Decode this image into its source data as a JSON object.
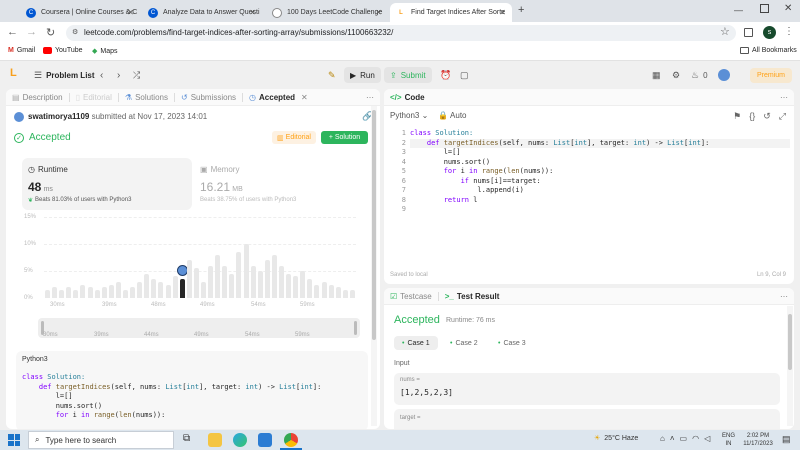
{
  "browser": {
    "tabs": [
      {
        "title": "Coursera | Online Courses & C"
      },
      {
        "title": "Analyze Data to Answer Questi"
      },
      {
        "title": "100 Days LeetCode Challenge"
      },
      {
        "title": "Find Target Indices After Sorte"
      }
    ],
    "new_tab": "+",
    "url": "leetcode.com/problems/find-target-indices-after-sorting-array/submissions/1100663232/",
    "profile_letter": "s",
    "bookmarks": [
      "Gmail",
      "YouTube",
      "Maps"
    ],
    "all_bookmarks": "All Bookmarks"
  },
  "lc_nav": {
    "problem_list": "Problem List",
    "run": "Run",
    "submit": "Submit",
    "notifications": "0",
    "premium": "Premium"
  },
  "left": {
    "tabs": [
      "Description",
      "Editorial",
      "Solutions",
      "Submissions",
      "Accepted"
    ],
    "user": "swatimorya1109",
    "submitted": "submitted at Nov 17, 2023 14:01",
    "status": "Accepted",
    "editorial_btn": "Editorial",
    "solution_btn": "+ Solution",
    "runtime": {
      "label": "Runtime",
      "value": "48",
      "unit": "ms",
      "beats": "Beats 81.03% of users with Python3"
    },
    "memory": {
      "label": "Memory",
      "value": "16.21",
      "unit": "MB",
      "beats": "Beats 38.75% of users with Python3"
    },
    "chart_y_ticks": [
      "15%",
      "10%",
      "5%",
      "0%"
    ],
    "chart_x_ticks": [
      "30ms",
      "39ms",
      "48ms",
      "49ms",
      "54ms",
      "59ms"
    ],
    "chart_x_ticks2": [
      "30ms",
      "39ms",
      "44ms",
      "49ms",
      "54ms",
      "59ms"
    ],
    "chart_data": {
      "type": "bar",
      "title": "",
      "xlabel": "",
      "ylabel": "",
      "ylim": [
        0,
        15
      ],
      "values": [
        1.5,
        2,
        1.5,
        2,
        1.5,
        2.5,
        2,
        1.5,
        2,
        2.5,
        3,
        1.5,
        2,
        3,
        4.5,
        3.5,
        3,
        2.5,
        4,
        6,
        7,
        5.5,
        3,
        6,
        8,
        6,
        4.5,
        8.5,
        10,
        6,
        5,
        7,
        8,
        6,
        4.5,
        4,
        5,
        3.5,
        2.5,
        3,
        2.5,
        2,
        1.5,
        1.5
      ],
      "highlight_index": 19,
      "highlight_value": 3.5
    },
    "code_lang": "Python3",
    "code_lines": [
      "class Solution:",
      "    def targetIndices(self, nums: List[int], target: int) -> List[int]:",
      "        l=[]",
      "        nums.sort()",
      "        for i in range(len(nums)):"
    ]
  },
  "editor": {
    "title": "Code",
    "lang": "Python3",
    "mode": "Auto",
    "line_numbers": [
      "1",
      "2",
      "3",
      "4",
      "5",
      "6",
      "7",
      "8",
      "9"
    ],
    "lines": [
      "class Solution:",
      "    def targetIndices(self, nums: List[int], target: int) -> List[int]:",
      "        l=[]",
      "        nums.sort()",
      "        for i in range(len(nums)):",
      "            if nums[i]==target:",
      "                l.append(i)",
      "        return l",
      ""
    ],
    "saved": "Saved to local",
    "cursor": "Ln 9, Col 9"
  },
  "testpanel": {
    "tab_testcase": "Testcase",
    "tab_result": "Test Result",
    "status": "Accepted",
    "runtime": "Runtime: 76 ms",
    "cases": [
      "Case 1",
      "Case 2",
      "Case 3"
    ],
    "input_label": "Input",
    "nums_label": "nums =",
    "nums_value": "[1,2,5,2,3]",
    "target_label": "target ="
  },
  "taskbar": {
    "search": "Type here to search",
    "weather": "25°C  Haze",
    "lang1": "ENG",
    "lang2": "IN",
    "time": "2:02 PM",
    "date": "11/17/2023"
  },
  "colors": {
    "accepted": "#2db55d",
    "premium": "#ffa116",
    "highlight_bar": "#262626"
  }
}
